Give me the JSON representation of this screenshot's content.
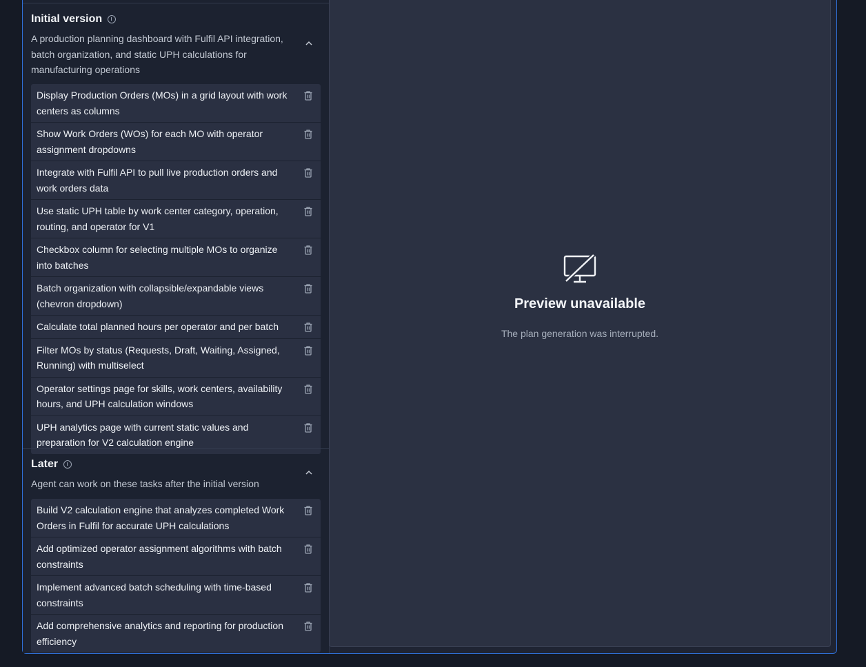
{
  "initial": {
    "title": "Initial version",
    "description": "A production planning dashboard with Fulfil API integration, batch organization, and static UPH calculations for manufacturing operations",
    "items": [
      "Display Production Orders (MOs) in a grid layout with work centers as columns",
      "Show Work Orders (WOs) for each MO with operator assignment dropdowns",
      "Integrate with Fulfil API to pull live production orders and work orders data",
      "Use static UPH table by work center category, operation, routing, and operator for V1",
      "Checkbox column for selecting multiple MOs to organize into batches",
      "Batch organization with collapsible/expandable views (chevron dropdown)",
      "Calculate total planned hours per operator and per batch",
      "Filter MOs by status (Requests, Draft, Waiting, Assigned, Running) with multiselect",
      "Operator settings page for skills, work centers, availability hours, and UPH calculation windows",
      "UPH analytics page with current static values and preparation for V2 calculation engine"
    ]
  },
  "later": {
    "title": "Later",
    "description": "Agent can work on these tasks after the initial version",
    "items": [
      "Build V2 calculation engine that analyzes completed Work Orders in Fulfil for accurate UPH calculations",
      "Add optimized operator assignment algorithms with batch constraints",
      "Implement advanced batch scheduling with time-based constraints",
      "Add comprehensive analytics and reporting for production efficiency"
    ]
  },
  "preview": {
    "icon": "monitor-off-icon",
    "title": "Preview unavailable",
    "subtitle": "The plan generation was interrupted."
  }
}
